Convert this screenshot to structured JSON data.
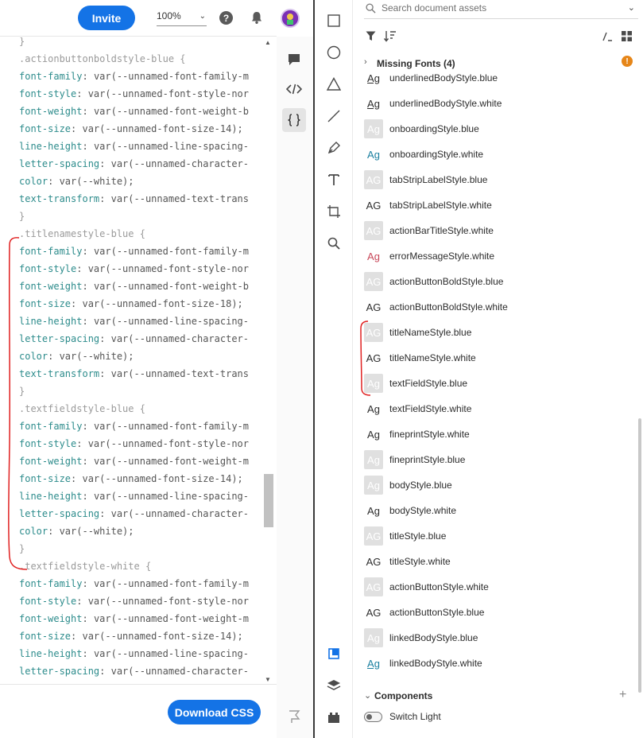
{
  "topbar": {
    "invite_label": "Invite",
    "zoom_value": "100%",
    "help_label": "?"
  },
  "code": {
    "lines": [
      {
        "sel": "}"
      },
      {
        "sel": ".actionbuttonboldstyle-blue {"
      },
      {
        "prop": "font-family",
        "val": "var(--unnamed-font-family-m"
      },
      {
        "prop": "font-style",
        "val": "var(--unnamed-font-style-nor"
      },
      {
        "prop": "font-weight",
        "val": "var(--unnamed-font-weight-b"
      },
      {
        "prop": "font-size",
        "val": "var(--unnamed-font-size-14);"
      },
      {
        "prop": "line-height",
        "val": "var(--unnamed-line-spacing-"
      },
      {
        "prop": "letter-spacing",
        "val": "var(--unnamed-character-"
      },
      {
        "prop": "color",
        "val": "var(--white);"
      },
      {
        "prop": "text-transform",
        "val": "var(--unnamed-text-trans"
      },
      {
        "sel": "}"
      },
      {
        "sel": ".titlenamestyle-blue {"
      },
      {
        "prop": "font-family",
        "val": "var(--unnamed-font-family-m"
      },
      {
        "prop": "font-style",
        "val": "var(--unnamed-font-style-nor"
      },
      {
        "prop": "font-weight",
        "val": "var(--unnamed-font-weight-b"
      },
      {
        "prop": "font-size",
        "val": "var(--unnamed-font-size-18);"
      },
      {
        "prop": "line-height",
        "val": "var(--unnamed-line-spacing-"
      },
      {
        "prop": "letter-spacing",
        "val": "var(--unnamed-character-"
      },
      {
        "prop": "color",
        "val": "var(--white);"
      },
      {
        "prop": "text-transform",
        "val": "var(--unnamed-text-trans"
      },
      {
        "sel": "}"
      },
      {
        "sel": ".textfieldstyle-blue {"
      },
      {
        "prop": "font-family",
        "val": "var(--unnamed-font-family-m"
      },
      {
        "prop": "font-style",
        "val": "var(--unnamed-font-style-nor"
      },
      {
        "prop": "font-weight",
        "val": "var(--unnamed-font-weight-m"
      },
      {
        "prop": "font-size",
        "val": "var(--unnamed-font-size-14);"
      },
      {
        "prop": "line-height",
        "val": "var(--unnamed-line-spacing-"
      },
      {
        "prop": "letter-spacing",
        "val": "var(--unnamed-character-"
      },
      {
        "prop": "color",
        "val": "var(--white);"
      },
      {
        "sel": "}"
      },
      {
        "sel": ".textfieldstyle-white {"
      },
      {
        "prop": "font-family",
        "val": "var(--unnamed-font-family-m"
      },
      {
        "prop": "font-style",
        "val": "var(--unnamed-font-style-nor"
      },
      {
        "prop": "font-weight",
        "val": "var(--unnamed-font-weight-m"
      },
      {
        "prop": "font-size",
        "val": "var(--unnamed-font-size-14);"
      },
      {
        "prop": "line-height",
        "val": "var(--unnamed-line-spacing-"
      },
      {
        "prop": "letter-spacing",
        "val": "var(--unnamed-character-"
      }
    ]
  },
  "download_label": "Download CSS",
  "assets": {
    "search_placeholder": "Search document assets",
    "missing_fonts_label": "Missing Fonts (4)",
    "warning_glyph": "!",
    "styles": [
      {
        "swatch": "Ag",
        "variant": "white",
        "label": "underlinedBodyStyle.blue"
      },
      {
        "swatch": "Ag",
        "variant": "white",
        "label": "underlinedBodyStyle.white"
      },
      {
        "swatch": "Ag",
        "variant": "blue",
        "label": "onboardingStyle.blue"
      },
      {
        "swatch": "Ag",
        "variant": "white",
        "label": "onboardingStyle.white"
      },
      {
        "swatch": "AG",
        "variant": "blue",
        "label": "tabStripLabelStyle.blue"
      },
      {
        "swatch": "AG",
        "variant": "white",
        "label": "tabStripLabelStyle.white"
      },
      {
        "swatch": "AG",
        "variant": "blue",
        "label": "actionBarTitleStyle.white"
      },
      {
        "swatch": "Ag",
        "variant": "white",
        "label": "errorMessageStyle.white"
      },
      {
        "swatch": "AG",
        "variant": "blue",
        "label": "actionButtonBoldStyle.blue"
      },
      {
        "swatch": "AG",
        "variant": "white",
        "label": "actionButtonBoldStyle.white"
      },
      {
        "swatch": "AG",
        "variant": "blue",
        "label": "titleNameStyle.blue"
      },
      {
        "swatch": "AG",
        "variant": "white",
        "label": "titleNameStyle.white"
      },
      {
        "swatch": "Ag",
        "variant": "blue",
        "label": "textFieldStyle.blue"
      },
      {
        "swatch": "Ag",
        "variant": "white",
        "label": "textFieldStyle.white"
      },
      {
        "swatch": "Ag",
        "variant": "white",
        "label": "fineprintStyle.white"
      },
      {
        "swatch": "Ag",
        "variant": "blue",
        "label": "fineprintStyle.blue"
      },
      {
        "swatch": "Ag",
        "variant": "blue",
        "label": "bodyStyle.blue"
      },
      {
        "swatch": "Ag",
        "variant": "white",
        "label": "bodyStyle.white"
      },
      {
        "swatch": "AG",
        "variant": "blue",
        "label": "titleStyle.blue"
      },
      {
        "swatch": "AG",
        "variant": "white",
        "label": "titleStyle.white"
      },
      {
        "swatch": "AG",
        "variant": "blue",
        "label": "actionButtonStyle.white"
      },
      {
        "swatch": "AG",
        "variant": "white",
        "label": "actionButtonStyle.blue"
      },
      {
        "swatch": "Ag",
        "variant": "blue",
        "label": "linkedBodyStyle.blue"
      },
      {
        "swatch": "Ag",
        "variant": "white",
        "label": "linkedBodyStyle.white"
      }
    ],
    "components_label": "Components",
    "components_add": "+",
    "switch_label": "Switch Light"
  },
  "colors": {
    "accent": "#1473e6",
    "code_property": "#2d8c8c",
    "error_swatch_text": "#c8485a",
    "teal_swatch_text": "#1a7fa0",
    "annotation_red": "#e02020"
  }
}
